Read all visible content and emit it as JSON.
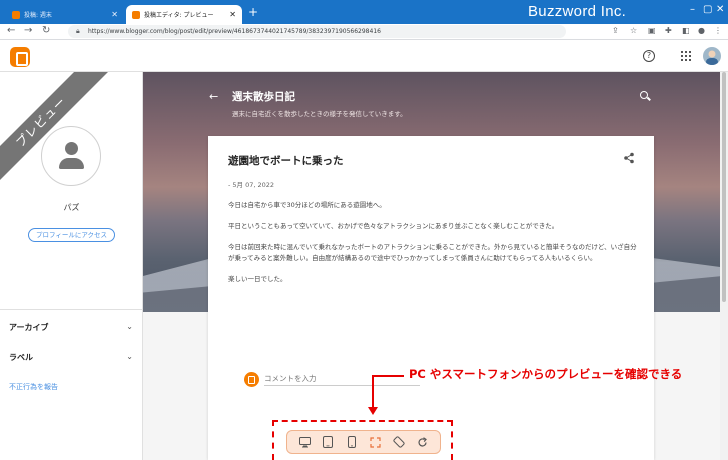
{
  "browser": {
    "tabs": [
      {
        "title": "投稿: 週末",
        "active": false
      },
      {
        "title": "投稿エディタ: プレビュー",
        "active": true
      }
    ],
    "new_tab": "+",
    "url": "https://www.blogger.com/blog/post/edit/preview/4618673744021745789/3832397190566298416",
    "brand": "Buzzword Inc."
  },
  "profile": {
    "ribbon": "プレビュー",
    "name": "パズ",
    "profile_button": "プロフィールにアクセス"
  },
  "sidebar": {
    "items": [
      {
        "label": "アーカイブ"
      },
      {
        "label": "ラベル"
      }
    ],
    "report": "不正行為を報告"
  },
  "blog": {
    "title": "週末散歩日記",
    "description": "週末に自宅近くを散歩したときの様子を発信していきます。"
  },
  "post": {
    "title": "遊園地でボートに乗った",
    "date": "- 5月 07, 2022",
    "paragraphs": [
      "今日は自宅から車で30分ほどの場所にある遊園地へ。",
      "平日ということもあって空いていて、おかげで色々なアトラクションにあまり並ぶことなく楽しむことができた。",
      "今日は前回来た時に混んでいて乗れなかったボートのアトラクションに乗ることができた。外から見ていると簡単そうなのだけど、いざ自分が乗ってみると案外難しい。自由度が結構あるので途中でひっかかってしまって係員さんに助けてもらってる人もいるくらい。",
      "楽しい一日でした。"
    ],
    "comment_placeholder": "コメントを入力"
  },
  "annotation": {
    "text": "PC やスマートフォンからのプレビューを確認できる",
    "color": "#e60000"
  },
  "device_toolbar": {
    "buttons": [
      "desktop-icon",
      "tablet-icon",
      "phone-icon",
      "fullscreen-icon",
      "rotate-icon",
      "refresh-icon"
    ]
  },
  "colors": {
    "accent": "#f57d00",
    "titlebar": "#1a73c7",
    "link": "#4a90e2"
  }
}
